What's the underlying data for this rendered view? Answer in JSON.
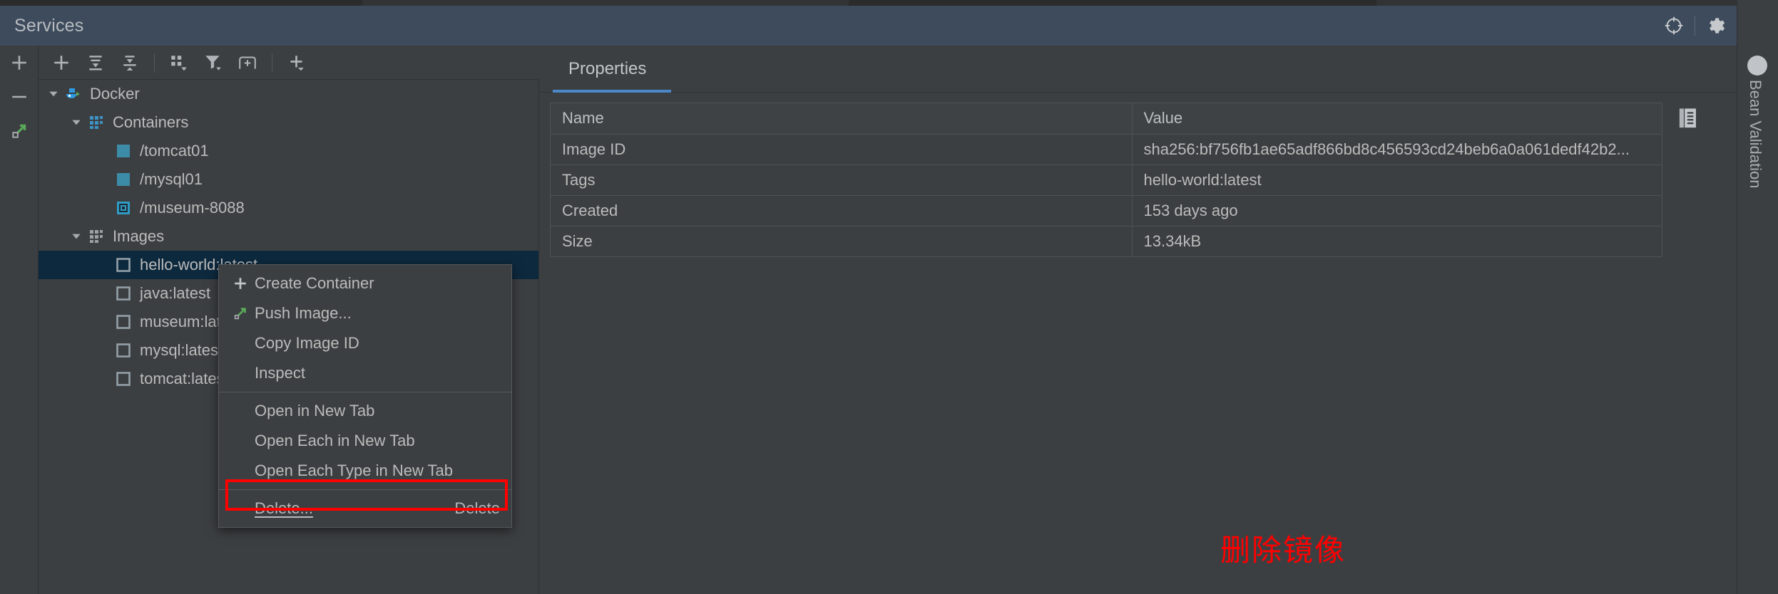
{
  "window": {
    "title": "Services",
    "header_icons": [
      {
        "name": "locate-icon",
        "glyph": "locate"
      },
      {
        "name": "settings-gear-icon",
        "glyph": "gear"
      },
      {
        "name": "minimize-icon",
        "glyph": "minus"
      }
    ],
    "accent_color": "#4a88c7",
    "titlebar_color": "#3d4b5c",
    "background_color": "#3c3f41"
  },
  "rail": {
    "buttons": [
      {
        "name": "add-service-button",
        "glyph": "plus"
      },
      {
        "name": "remove-service-button",
        "glyph": "minus"
      },
      {
        "name": "jump-to-source-button",
        "glyph": "arrow-out"
      }
    ]
  },
  "tree_toolbar": {
    "buttons": [
      {
        "name": "add-button",
        "glyph": "plus"
      },
      {
        "name": "expand-all-button",
        "glyph": "expand-all"
      },
      {
        "name": "collapse-all-button",
        "glyph": "collapse-all"
      },
      {
        "name": "group-by-button",
        "glyph": "group"
      },
      {
        "name": "filter-button",
        "glyph": "filter"
      },
      {
        "name": "new-tab-button",
        "glyph": "new-tab"
      },
      {
        "name": "more-add-button",
        "glyph": "plus-dropdown"
      }
    ]
  },
  "tree": {
    "nodes": [
      {
        "label": "Docker",
        "depth": 0,
        "icon": "docker-whale-icon",
        "expanded": true,
        "selected": false
      },
      {
        "label": "Containers",
        "depth": 1,
        "icon": "containers-grid-icon",
        "expanded": true,
        "selected": false
      },
      {
        "label": "/tomcat01",
        "depth": 2,
        "icon": "container-running-icon",
        "expanded": null,
        "selected": false
      },
      {
        "label": "/mysql01",
        "depth": 2,
        "icon": "container-running-icon",
        "expanded": null,
        "selected": false
      },
      {
        "label": "/museum-8088",
        "depth": 2,
        "icon": "container-stopped-icon",
        "expanded": null,
        "selected": false
      },
      {
        "label": "Images",
        "depth": 1,
        "icon": "images-grid-icon",
        "expanded": true,
        "selected": false
      },
      {
        "label": "hello-world:latest",
        "depth": 2,
        "icon": "image-square-icon",
        "expanded": null,
        "selected": true
      },
      {
        "label": "java:latest",
        "depth": 2,
        "icon": "image-square-icon",
        "expanded": null,
        "selected": false
      },
      {
        "label": "museum:latest",
        "depth": 2,
        "icon": "image-square-icon",
        "expanded": null,
        "selected": false
      },
      {
        "label": "mysql:latest",
        "depth": 2,
        "icon": "image-square-icon",
        "expanded": null,
        "selected": false
      },
      {
        "label": "tomcat:latest",
        "depth": 2,
        "icon": "image-square-icon",
        "expanded": null,
        "selected": false
      }
    ]
  },
  "properties": {
    "tabs": [
      {
        "label": "Properties",
        "active": true
      }
    ],
    "columns": [
      "Name",
      "Value"
    ],
    "rows": [
      {
        "name": "Image ID",
        "value": "sha256:bf756fb1ae65adf866bd8c456593cd24beb6a0a061dedf42b2..."
      },
      {
        "name": "Tags",
        "value": "hello-world:latest"
      },
      {
        "name": "Created",
        "value": "153 days ago"
      },
      {
        "name": "Size",
        "value": "13.34kB"
      }
    ],
    "copy_button": {
      "name": "copy-icon",
      "title": "Copy"
    }
  },
  "context_menu": {
    "items": [
      {
        "label": "Create Container",
        "icon": "plus-icon",
        "accel": "",
        "separator_after": false
      },
      {
        "label": "Push Image...",
        "icon": "push-arrow-icon",
        "accel": "",
        "separator_after": false
      },
      {
        "label": "Copy Image ID",
        "icon": "",
        "accel": "",
        "separator_after": false
      },
      {
        "label": "Inspect",
        "icon": "",
        "accel": "",
        "separator_after": true
      },
      {
        "label": "Open in New Tab",
        "icon": "",
        "accel": "",
        "separator_after": false
      },
      {
        "label": "Open Each in New Tab",
        "icon": "",
        "accel": "",
        "separator_after": false
      },
      {
        "label": "Open Each Type in New Tab",
        "icon": "",
        "accel": "",
        "separator_after": true
      },
      {
        "label": "Delete...",
        "icon": "",
        "accel": "Delete",
        "separator_after": false
      }
    ]
  },
  "annotation": {
    "text": "删除镜像",
    "color": "#ff0000"
  },
  "right_rail": {
    "vertical_label": "Bean Validation"
  }
}
